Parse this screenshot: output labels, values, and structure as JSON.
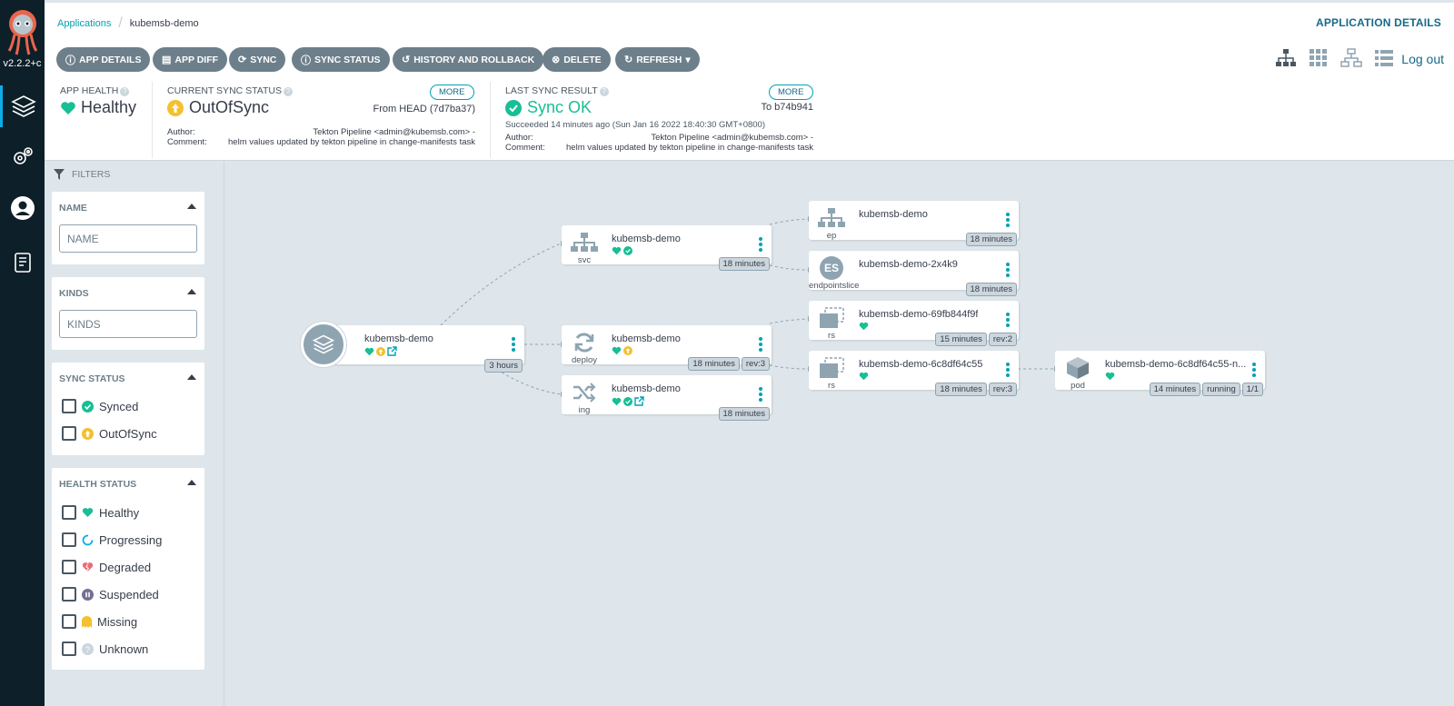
{
  "nav": {
    "version": "v2.2.2+c"
  },
  "header": {
    "breadcrumb_root": "Applications",
    "breadcrumb_current": "kubemsb-demo",
    "title": "APPLICATION DETAILS"
  },
  "toolbar": {
    "buttons": [
      "APP DETAILS",
      "APP DIFF",
      "SYNC",
      "SYNC STATUS",
      "HISTORY AND ROLLBACK",
      "DELETE",
      "REFRESH"
    ],
    "logout": "Log out"
  },
  "status": {
    "app_health": {
      "title": "APP HEALTH",
      "value": "Healthy"
    },
    "current_sync": {
      "title": "CURRENT SYNC STATUS",
      "value": "OutOfSync",
      "more": "MORE",
      "from": "From HEAD (7d7ba37)",
      "author_label": "Author:",
      "author": "Tekton Pipeline <admin@kubemsb.com> -",
      "comment_label": "Comment:",
      "comment": "helm values updated by tekton pipeline in change-manifests task"
    },
    "last_sync": {
      "title": "LAST SYNC RESULT",
      "value": "Sync OK",
      "more": "MORE",
      "to": "To b74b941",
      "succeeded": "Succeeded 14 minutes ago (Sun Jan 16 2022 18:40:30 GMT+0800)",
      "author_label": "Author:",
      "author": "Tekton Pipeline <admin@kubemsb.com> -",
      "comment_label": "Comment:",
      "comment": "helm values updated by tekton pipeline in change-manifests task"
    }
  },
  "filters": {
    "label": "FILTERS",
    "name": {
      "title": "NAME",
      "placeholder": "NAME"
    },
    "kinds": {
      "title": "KINDS",
      "placeholder": "KINDS"
    },
    "sync_status": {
      "title": "SYNC STATUS",
      "options": [
        "Synced",
        "OutOfSync"
      ]
    },
    "health_status": {
      "title": "HEALTH STATUS",
      "options": [
        "Healthy",
        "Progressing",
        "Degraded",
        "Suspended",
        "Missing",
        "Unknown"
      ]
    }
  },
  "graph": {
    "app": {
      "name": "kubemsb-demo",
      "age": "3 hours"
    },
    "svc": {
      "name": "kubemsb-demo",
      "kind": "svc",
      "age": "18 minutes"
    },
    "deploy": {
      "name": "kubemsb-demo",
      "kind": "deploy",
      "age": "18 minutes",
      "rev": "rev:3"
    },
    "ing": {
      "name": "kubemsb-demo",
      "kind": "ing",
      "age": "18 minutes"
    },
    "ep": {
      "name": "kubemsb-demo",
      "kind": "ep",
      "age": "18 minutes"
    },
    "eps": {
      "name": "kubemsb-demo-2x4k9",
      "kind": "endpointslice",
      "badge": "ES",
      "age": "18 minutes"
    },
    "rs1": {
      "name": "kubemsb-demo-69fb844f9f",
      "kind": "rs",
      "age": "15 minutes",
      "rev": "rev:2"
    },
    "rs2": {
      "name": "kubemsb-demo-6c8df64c55",
      "kind": "rs",
      "age": "18 minutes",
      "rev": "rev:3"
    },
    "pod": {
      "name": "kubemsb-demo-6c8df64c55-n...",
      "kind": "pod",
      "age": "14 minutes",
      "state": "running",
      "ready": "1/1"
    }
  },
  "colors": {
    "healthy": "#18be94",
    "outofsync": "#f4c030",
    "accent": "#00a2b3",
    "degraded": "#e96d76"
  }
}
